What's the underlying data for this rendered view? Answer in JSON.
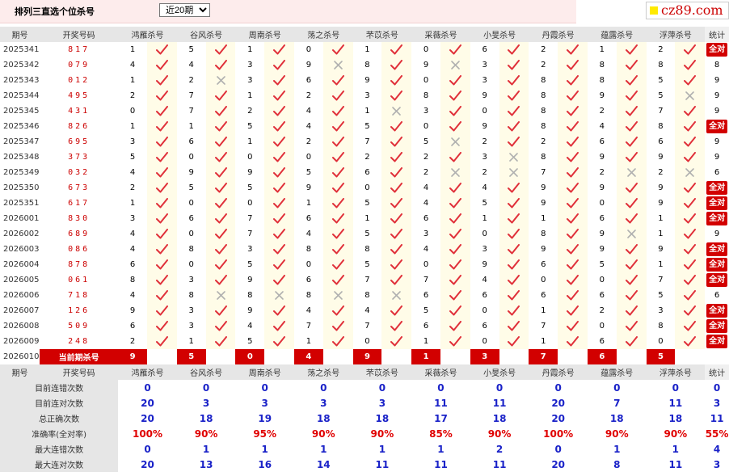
{
  "title": "排列三直选个位杀号",
  "period_select": {
    "selected": "近20期"
  },
  "site": "cz89.com",
  "header": {
    "period": "期号",
    "draw": "开奖号码",
    "stat": "统计"
  },
  "columns": [
    "鸿雁杀号",
    "谷风杀号",
    "周南杀号",
    "荡之杀号",
    "芣苡杀号",
    "采薇杀号",
    "小旻杀号",
    "丹霞杀号",
    "蕴露杀号",
    "浮萍杀号"
  ],
  "rows": [
    {
      "period": "2025341",
      "draw": "817",
      "vals": [
        [
          1,
          1
        ],
        [
          5,
          1
        ],
        [
          1,
          1
        ],
        [
          0,
          1
        ],
        [
          1,
          1
        ],
        [
          0,
          1
        ],
        [
          6,
          1
        ],
        [
          2,
          1
        ],
        [
          1,
          1
        ],
        [
          2,
          1
        ]
      ],
      "stat": "全对"
    },
    {
      "period": "2025342",
      "draw": "079",
      "vals": [
        [
          4,
          1
        ],
        [
          4,
          1
        ],
        [
          3,
          1
        ],
        [
          9,
          0
        ],
        [
          8,
          1
        ],
        [
          9,
          0
        ],
        [
          3,
          1
        ],
        [
          2,
          1
        ],
        [
          8,
          1
        ],
        [
          8,
          1
        ]
      ],
      "stat": "8"
    },
    {
      "period": "2025343",
      "draw": "012",
      "vals": [
        [
          1,
          1
        ],
        [
          2,
          0
        ],
        [
          3,
          1
        ],
        [
          6,
          1
        ],
        [
          9,
          1
        ],
        [
          0,
          1
        ],
        [
          3,
          1
        ],
        [
          8,
          1
        ],
        [
          8,
          1
        ],
        [
          5,
          1
        ]
      ],
      "stat": "9"
    },
    {
      "period": "2025344",
      "draw": "495",
      "vals": [
        [
          2,
          1
        ],
        [
          7,
          1
        ],
        [
          1,
          1
        ],
        [
          2,
          1
        ],
        [
          3,
          1
        ],
        [
          8,
          1
        ],
        [
          9,
          1
        ],
        [
          8,
          1
        ],
        [
          9,
          1
        ],
        [
          5,
          0
        ]
      ],
      "stat": "9"
    },
    {
      "period": "2025345",
      "draw": "431",
      "vals": [
        [
          0,
          1
        ],
        [
          7,
          1
        ],
        [
          2,
          1
        ],
        [
          4,
          1
        ],
        [
          1,
          0
        ],
        [
          3,
          1
        ],
        [
          0,
          1
        ],
        [
          8,
          1
        ],
        [
          2,
          1
        ],
        [
          7,
          1
        ]
      ],
      "stat": "9"
    },
    {
      "period": "2025346",
      "draw": "826",
      "vals": [
        [
          1,
          1
        ],
        [
          1,
          1
        ],
        [
          5,
          1
        ],
        [
          4,
          1
        ],
        [
          5,
          1
        ],
        [
          0,
          1
        ],
        [
          9,
          1
        ],
        [
          8,
          1
        ],
        [
          4,
          1
        ],
        [
          8,
          1
        ]
      ],
      "stat": "全对"
    },
    {
      "period": "2025347",
      "draw": "695",
      "vals": [
        [
          3,
          1
        ],
        [
          6,
          1
        ],
        [
          1,
          1
        ],
        [
          2,
          1
        ],
        [
          7,
          1
        ],
        [
          5,
          0
        ],
        [
          2,
          1
        ],
        [
          2,
          1
        ],
        [
          6,
          1
        ],
        [
          6,
          1
        ]
      ],
      "stat": "9"
    },
    {
      "period": "2025348",
      "draw": "373",
      "vals": [
        [
          5,
          1
        ],
        [
          0,
          1
        ],
        [
          0,
          1
        ],
        [
          0,
          1
        ],
        [
          2,
          1
        ],
        [
          2,
          1
        ],
        [
          3,
          0
        ],
        [
          8,
          1
        ],
        [
          9,
          1
        ],
        [
          9,
          1
        ]
      ],
      "stat": "9"
    },
    {
      "period": "2025349",
      "draw": "032",
      "vals": [
        [
          4,
          1
        ],
        [
          9,
          1
        ],
        [
          9,
          1
        ],
        [
          5,
          1
        ],
        [
          6,
          1
        ],
        [
          2,
          0
        ],
        [
          2,
          0
        ],
        [
          7,
          1
        ],
        [
          2,
          0
        ],
        [
          2,
          0
        ]
      ],
      "stat": "6"
    },
    {
      "period": "2025350",
      "draw": "673",
      "vals": [
        [
          2,
          1
        ],
        [
          5,
          1
        ],
        [
          5,
          1
        ],
        [
          9,
          1
        ],
        [
          0,
          1
        ],
        [
          4,
          1
        ],
        [
          4,
          1
        ],
        [
          9,
          1
        ],
        [
          9,
          1
        ],
        [
          9,
          1
        ]
      ],
      "stat": "全对"
    },
    {
      "period": "2025351",
      "draw": "617",
      "vals": [
        [
          1,
          1
        ],
        [
          0,
          1
        ],
        [
          0,
          1
        ],
        [
          1,
          1
        ],
        [
          5,
          1
        ],
        [
          4,
          1
        ],
        [
          5,
          1
        ],
        [
          9,
          1
        ],
        [
          0,
          1
        ],
        [
          9,
          1
        ]
      ],
      "stat": "全对"
    },
    {
      "period": "2026001",
      "draw": "830",
      "vals": [
        [
          3,
          1
        ],
        [
          6,
          1
        ],
        [
          7,
          1
        ],
        [
          6,
          1
        ],
        [
          1,
          1
        ],
        [
          6,
          1
        ],
        [
          1,
          1
        ],
        [
          1,
          1
        ],
        [
          6,
          1
        ],
        [
          1,
          1
        ]
      ],
      "stat": "全对"
    },
    {
      "period": "2026002",
      "draw": "689",
      "vals": [
        [
          4,
          1
        ],
        [
          0,
          1
        ],
        [
          7,
          1
        ],
        [
          4,
          1
        ],
        [
          5,
          1
        ],
        [
          3,
          1
        ],
        [
          0,
          1
        ],
        [
          8,
          1
        ],
        [
          9,
          0
        ],
        [
          1,
          1
        ]
      ],
      "stat": "9"
    },
    {
      "period": "2026003",
      "draw": "086",
      "vals": [
        [
          4,
          1
        ],
        [
          8,
          1
        ],
        [
          3,
          1
        ],
        [
          8,
          1
        ],
        [
          8,
          1
        ],
        [
          4,
          1
        ],
        [
          3,
          1
        ],
        [
          9,
          1
        ],
        [
          9,
          1
        ],
        [
          9,
          1
        ]
      ],
      "stat": "全对"
    },
    {
      "period": "2026004",
      "draw": "878",
      "vals": [
        [
          6,
          1
        ],
        [
          0,
          1
        ],
        [
          5,
          1
        ],
        [
          0,
          1
        ],
        [
          5,
          1
        ],
        [
          0,
          1
        ],
        [
          9,
          1
        ],
        [
          6,
          1
        ],
        [
          5,
          1
        ],
        [
          1,
          1
        ]
      ],
      "stat": "全对"
    },
    {
      "period": "2026005",
      "draw": "061",
      "vals": [
        [
          8,
          1
        ],
        [
          3,
          1
        ],
        [
          9,
          1
        ],
        [
          6,
          1
        ],
        [
          7,
          1
        ],
        [
          7,
          1
        ],
        [
          4,
          1
        ],
        [
          0,
          1
        ],
        [
          0,
          1
        ],
        [
          7,
          1
        ]
      ],
      "stat": "全对"
    },
    {
      "period": "2026006",
      "draw": "718",
      "vals": [
        [
          4,
          1
        ],
        [
          8,
          0
        ],
        [
          8,
          0
        ],
        [
          8,
          0
        ],
        [
          8,
          0
        ],
        [
          6,
          1
        ],
        [
          6,
          1
        ],
        [
          6,
          1
        ],
        [
          6,
          1
        ],
        [
          5,
          1
        ]
      ],
      "stat": "6"
    },
    {
      "period": "2026007",
      "draw": "126",
      "vals": [
        [
          9,
          1
        ],
        [
          3,
          1
        ],
        [
          9,
          1
        ],
        [
          4,
          1
        ],
        [
          4,
          1
        ],
        [
          5,
          1
        ],
        [
          0,
          1
        ],
        [
          1,
          1
        ],
        [
          2,
          1
        ],
        [
          3,
          1
        ]
      ],
      "stat": "全对"
    },
    {
      "period": "2026008",
      "draw": "509",
      "vals": [
        [
          6,
          1
        ],
        [
          3,
          1
        ],
        [
          4,
          1
        ],
        [
          7,
          1
        ],
        [
          7,
          1
        ],
        [
          6,
          1
        ],
        [
          6,
          1
        ],
        [
          7,
          1
        ],
        [
          0,
          1
        ],
        [
          8,
          1
        ]
      ],
      "stat": "全对"
    },
    {
      "period": "2026009",
      "draw": "248",
      "vals": [
        [
          2,
          1
        ],
        [
          1,
          1
        ],
        [
          5,
          1
        ],
        [
          1,
          1
        ],
        [
          0,
          1
        ],
        [
          1,
          1
        ],
        [
          0,
          1
        ],
        [
          1,
          1
        ],
        [
          6,
          1
        ],
        [
          0,
          1
        ]
      ],
      "stat": "全对"
    }
  ],
  "current": {
    "period": "2026010",
    "label": "当前期杀号",
    "vals": [
      "9",
      "5",
      "0",
      "4",
      "9",
      "1",
      "3",
      "7",
      "6",
      "5"
    ]
  },
  "stats": [
    {
      "label": "目前连错次数",
      "vals": [
        "0",
        "0",
        "0",
        "0",
        "0",
        "0",
        "0",
        "0",
        "0",
        "0"
      ],
      "total": "0"
    },
    {
      "label": "目前连对次数",
      "vals": [
        "20",
        "3",
        "3",
        "3",
        "3",
        "11",
        "11",
        "20",
        "7",
        "11"
      ],
      "total": "3"
    },
    {
      "label": "总正确次数",
      "vals": [
        "20",
        "18",
        "19",
        "18",
        "18",
        "17",
        "18",
        "20",
        "18",
        "18"
      ],
      "total": "11"
    },
    {
      "label": "准确率(全对率)",
      "vals": [
        "100%",
        "90%",
        "95%",
        "90%",
        "90%",
        "85%",
        "90%",
        "100%",
        "90%",
        "90%"
      ],
      "total": "55%",
      "pct": true
    },
    {
      "label": "最大连错次数",
      "vals": [
        "0",
        "1",
        "1",
        "1",
        "1",
        "1",
        "2",
        "0",
        "1",
        "1"
      ],
      "total": "4"
    },
    {
      "label": "最大连对次数",
      "vals": [
        "20",
        "13",
        "16",
        "14",
        "11",
        "11",
        "11",
        "20",
        "8",
        "11"
      ],
      "total": "3"
    }
  ],
  "colors": {
    "accent": "#d20000",
    "check": "#e0303a",
    "cross": "#b0b0b0",
    "stat_blue": "#1a22c8",
    "stat_red": "#e00000"
  },
  "icons": {
    "ok": "check-icon",
    "miss": "cross-icon"
  }
}
